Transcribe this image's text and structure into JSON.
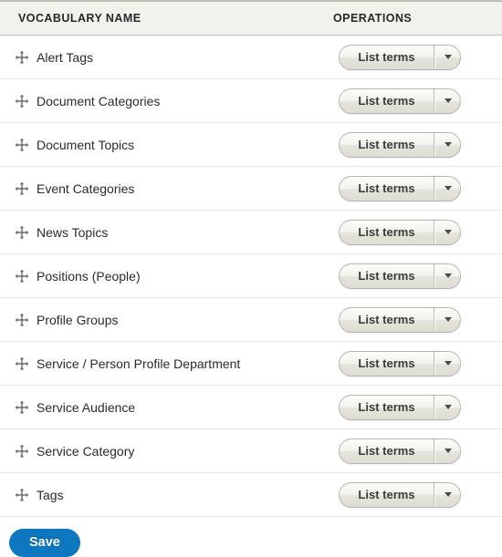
{
  "table": {
    "columns": [
      {
        "key": "name",
        "label": "VOCABULARY NAME"
      },
      {
        "key": "operations",
        "label": "OPERATIONS"
      }
    ],
    "drag_handle_icon": "move-arrows-icon",
    "rows": [
      {
        "name": "Alert Tags",
        "operation_label": "List terms",
        "dropdown_icon": "caret-down-icon"
      },
      {
        "name": "Document Categories",
        "operation_label": "List terms",
        "dropdown_icon": "caret-down-icon"
      },
      {
        "name": "Document Topics",
        "operation_label": "List terms",
        "dropdown_icon": "caret-down-icon"
      },
      {
        "name": "Event Categories",
        "operation_label": "List terms",
        "dropdown_icon": "caret-down-icon"
      },
      {
        "name": "News Topics",
        "operation_label": "List terms",
        "dropdown_icon": "caret-down-icon"
      },
      {
        "name": "Positions (People)",
        "operation_label": "List terms",
        "dropdown_icon": "caret-down-icon"
      },
      {
        "name": "Profile Groups",
        "operation_label": "List terms",
        "dropdown_icon": "caret-down-icon"
      },
      {
        "name": "Service / Person Profile Department",
        "operation_label": "List terms",
        "dropdown_icon": "caret-down-icon"
      },
      {
        "name": "Service Audience",
        "operation_label": "List terms",
        "dropdown_icon": "caret-down-icon"
      },
      {
        "name": "Service Category",
        "operation_label": "List terms",
        "dropdown_icon": "caret-down-icon"
      },
      {
        "name": "Tags",
        "operation_label": "List terms",
        "dropdown_icon": "caret-down-icon"
      }
    ]
  },
  "actions": {
    "save_label": "Save"
  },
  "colors": {
    "header_background": "#f2f1ec",
    "header_border": "#bfbfb6",
    "row_divider": "#e4e4e0",
    "text": "#2b2b2b",
    "save_button": "#0d77bf",
    "button_border": "#b7b5ac"
  }
}
